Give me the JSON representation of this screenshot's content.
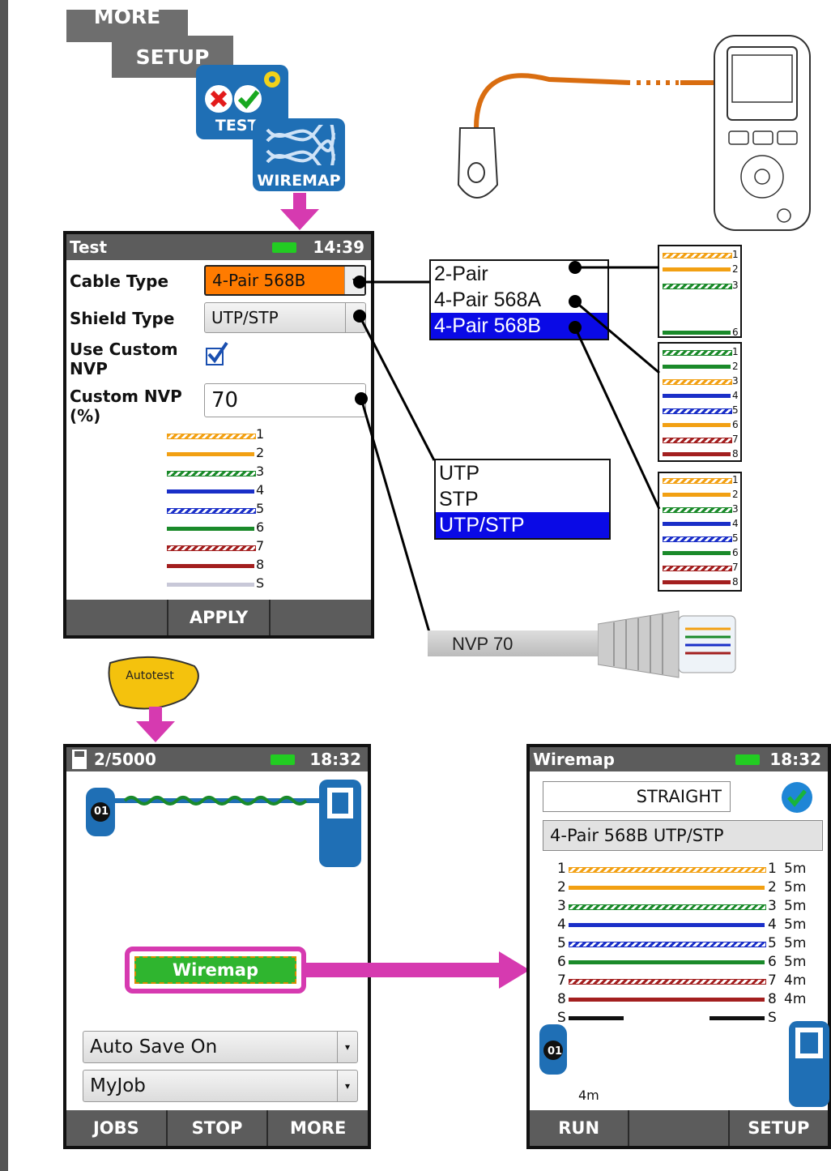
{
  "menu": {
    "more_tab": "MORE",
    "setup_tab": "SETUP",
    "tests_tile": "TESTS",
    "wiremap_tile": "WIREMAP"
  },
  "test_screen": {
    "title": "Test",
    "time": "14:39",
    "cable_type_label": "Cable Type",
    "cable_type_value": "4-Pair 568B",
    "shield_type_label": "Shield Type",
    "shield_type_value": "UTP/STP",
    "use_custom_nvp_label": "Use Custom NVP",
    "custom_nvp_label": "Custom NVP (%)",
    "custom_nvp_value": "70",
    "apply_label": "APPLY",
    "wire_labels": [
      "1",
      "2",
      "3",
      "4",
      "5",
      "6",
      "7",
      "8",
      "S"
    ]
  },
  "cable_type_menu": {
    "options": [
      "2-Pair",
      "4-Pair 568A",
      "4-Pair 568B"
    ],
    "selected": 2
  },
  "shield_type_menu": {
    "options": [
      "UTP",
      "STP",
      "UTP/STP"
    ],
    "selected": 2
  },
  "wire_diagrams": {
    "two_pair_labels": [
      "1",
      "2",
      "3",
      "6"
    ],
    "four_pair_labels": [
      "1",
      "2",
      "3",
      "4",
      "5",
      "6",
      "7",
      "8"
    ]
  },
  "connector": {
    "nvp_label": "NVP 70"
  },
  "autotest": {
    "button_label": "Autotest"
  },
  "autotest_screen": {
    "counter": "2/5000",
    "time": "18:32",
    "remote_id": "01",
    "wiremap_button": "Wiremap",
    "auto_save_value": "Auto Save On",
    "job_value": "MyJob",
    "softkeys": [
      "JOBS",
      "STOP",
      "MORE"
    ]
  },
  "wiremap_screen": {
    "title": "Wiremap",
    "time": "18:32",
    "result": "STRAIGHT",
    "cable_config": "4-Pair 568B UTP/STP",
    "wires": [
      {
        "left": "1",
        "right": "1",
        "length": "5m"
      },
      {
        "left": "2",
        "right": "2",
        "length": "5m"
      },
      {
        "left": "3",
        "right": "3",
        "length": "5m"
      },
      {
        "left": "4",
        "right": "4",
        "length": "5m"
      },
      {
        "left": "5",
        "right": "5",
        "length": "5m"
      },
      {
        "left": "6",
        "right": "6",
        "length": "5m"
      },
      {
        "left": "7",
        "right": "7",
        "length": "4m"
      },
      {
        "left": "8",
        "right": "8",
        "length": "4m"
      },
      {
        "left": "S",
        "right": "S",
        "length": ""
      }
    ],
    "shield_length": "4m",
    "remote_id": "01",
    "softkeys": [
      "RUN",
      "",
      "SETUP"
    ]
  },
  "colors": {
    "orange": "#f2a013",
    "green": "#1a8a2a",
    "blue": "#1a2fc8",
    "brown": "#a31f1f",
    "shield": "#c8c8d8",
    "magenta": "#d63ab0",
    "selection": "#0a0ae6",
    "highlight_orange": "#ff7b00",
    "battery": "#22cc22",
    "tile_blue": "#1f6fb5"
  }
}
